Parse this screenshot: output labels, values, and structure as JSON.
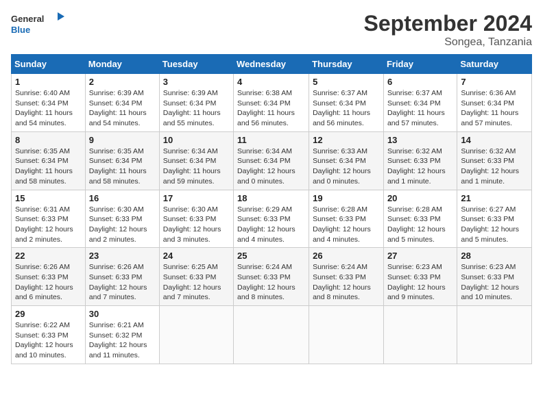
{
  "header": {
    "logo_line1": "General",
    "logo_line2": "Blue",
    "month_title": "September 2024",
    "subtitle": "Songea, Tanzania"
  },
  "columns": [
    "Sunday",
    "Monday",
    "Tuesday",
    "Wednesday",
    "Thursday",
    "Friday",
    "Saturday"
  ],
  "weeks": [
    [
      {
        "day": "1",
        "info": "Sunrise: 6:40 AM\nSunset: 6:34 PM\nDaylight: 11 hours\nand 54 minutes."
      },
      {
        "day": "2",
        "info": "Sunrise: 6:39 AM\nSunset: 6:34 PM\nDaylight: 11 hours\nand 54 minutes."
      },
      {
        "day": "3",
        "info": "Sunrise: 6:39 AM\nSunset: 6:34 PM\nDaylight: 11 hours\nand 55 minutes."
      },
      {
        "day": "4",
        "info": "Sunrise: 6:38 AM\nSunset: 6:34 PM\nDaylight: 11 hours\nand 56 minutes."
      },
      {
        "day": "5",
        "info": "Sunrise: 6:37 AM\nSunset: 6:34 PM\nDaylight: 11 hours\nand 56 minutes."
      },
      {
        "day": "6",
        "info": "Sunrise: 6:37 AM\nSunset: 6:34 PM\nDaylight: 11 hours\nand 57 minutes."
      },
      {
        "day": "7",
        "info": "Sunrise: 6:36 AM\nSunset: 6:34 PM\nDaylight: 11 hours\nand 57 minutes."
      }
    ],
    [
      {
        "day": "8",
        "info": "Sunrise: 6:35 AM\nSunset: 6:34 PM\nDaylight: 11 hours\nand 58 minutes."
      },
      {
        "day": "9",
        "info": "Sunrise: 6:35 AM\nSunset: 6:34 PM\nDaylight: 11 hours\nand 58 minutes."
      },
      {
        "day": "10",
        "info": "Sunrise: 6:34 AM\nSunset: 6:34 PM\nDaylight: 11 hours\nand 59 minutes."
      },
      {
        "day": "11",
        "info": "Sunrise: 6:34 AM\nSunset: 6:34 PM\nDaylight: 12 hours\nand 0 minutes."
      },
      {
        "day": "12",
        "info": "Sunrise: 6:33 AM\nSunset: 6:34 PM\nDaylight: 12 hours\nand 0 minutes."
      },
      {
        "day": "13",
        "info": "Sunrise: 6:32 AM\nSunset: 6:33 PM\nDaylight: 12 hours\nand 1 minute."
      },
      {
        "day": "14",
        "info": "Sunrise: 6:32 AM\nSunset: 6:33 PM\nDaylight: 12 hours\nand 1 minute."
      }
    ],
    [
      {
        "day": "15",
        "info": "Sunrise: 6:31 AM\nSunset: 6:33 PM\nDaylight: 12 hours\nand 2 minutes."
      },
      {
        "day": "16",
        "info": "Sunrise: 6:30 AM\nSunset: 6:33 PM\nDaylight: 12 hours\nand 2 minutes."
      },
      {
        "day": "17",
        "info": "Sunrise: 6:30 AM\nSunset: 6:33 PM\nDaylight: 12 hours\nand 3 minutes."
      },
      {
        "day": "18",
        "info": "Sunrise: 6:29 AM\nSunset: 6:33 PM\nDaylight: 12 hours\nand 4 minutes."
      },
      {
        "day": "19",
        "info": "Sunrise: 6:28 AM\nSunset: 6:33 PM\nDaylight: 12 hours\nand 4 minutes."
      },
      {
        "day": "20",
        "info": "Sunrise: 6:28 AM\nSunset: 6:33 PM\nDaylight: 12 hours\nand 5 minutes."
      },
      {
        "day": "21",
        "info": "Sunrise: 6:27 AM\nSunset: 6:33 PM\nDaylight: 12 hours\nand 5 minutes."
      }
    ],
    [
      {
        "day": "22",
        "info": "Sunrise: 6:26 AM\nSunset: 6:33 PM\nDaylight: 12 hours\nand 6 minutes."
      },
      {
        "day": "23",
        "info": "Sunrise: 6:26 AM\nSunset: 6:33 PM\nDaylight: 12 hours\nand 7 minutes."
      },
      {
        "day": "24",
        "info": "Sunrise: 6:25 AM\nSunset: 6:33 PM\nDaylight: 12 hours\nand 7 minutes."
      },
      {
        "day": "25",
        "info": "Sunrise: 6:24 AM\nSunset: 6:33 PM\nDaylight: 12 hours\nand 8 minutes."
      },
      {
        "day": "26",
        "info": "Sunrise: 6:24 AM\nSunset: 6:33 PM\nDaylight: 12 hours\nand 8 minutes."
      },
      {
        "day": "27",
        "info": "Sunrise: 6:23 AM\nSunset: 6:33 PM\nDaylight: 12 hours\nand 9 minutes."
      },
      {
        "day": "28",
        "info": "Sunrise: 6:23 AM\nSunset: 6:33 PM\nDaylight: 12 hours\nand 10 minutes."
      }
    ],
    [
      {
        "day": "29",
        "info": "Sunrise: 6:22 AM\nSunset: 6:33 PM\nDaylight: 12 hours\nand 10 minutes."
      },
      {
        "day": "30",
        "info": "Sunrise: 6:21 AM\nSunset: 6:32 PM\nDaylight: 12 hours\nand 11 minutes."
      },
      {
        "day": "",
        "info": ""
      },
      {
        "day": "",
        "info": ""
      },
      {
        "day": "",
        "info": ""
      },
      {
        "day": "",
        "info": ""
      },
      {
        "day": "",
        "info": ""
      }
    ]
  ]
}
